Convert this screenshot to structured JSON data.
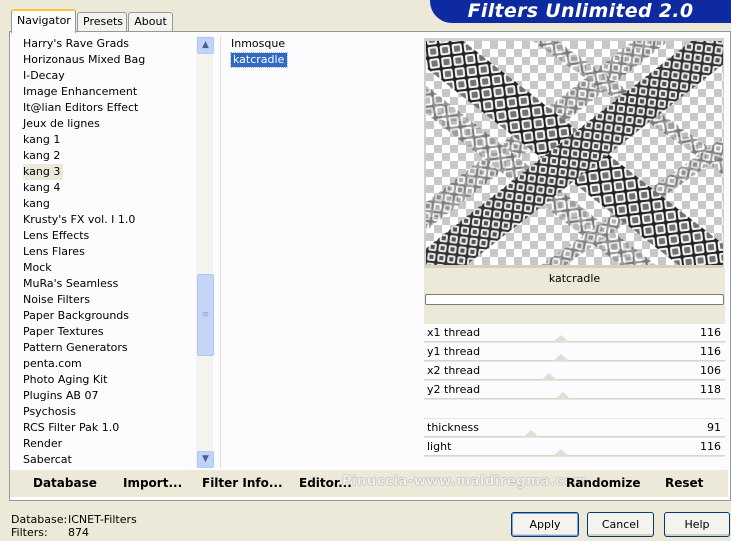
{
  "window": {
    "banner_title": "Filters Unlimited 2.0"
  },
  "tabs": [
    {
      "label": "Navigator",
      "active": true
    },
    {
      "label": "Presets",
      "active": false
    },
    {
      "label": "About",
      "active": false
    }
  ],
  "categories": {
    "selected": "kang 3",
    "items": [
      "Harry's Rave Grads",
      "Horizonaus Mixed Bag",
      "I-Decay",
      "Image Enhancement",
      "It@lian Editors Effect",
      "Jeux de lignes",
      "kang 1",
      "kang 2",
      "kang 3",
      "kang 4",
      "kang",
      "Krusty's FX vol. I 1.0",
      "Lens Effects",
      "Lens Flares",
      "Mock",
      "MuRa's Seamless",
      "Noise Filters",
      "Paper Backgrounds",
      "Paper Textures",
      "Pattern Generators",
      "penta.com",
      "Photo Aging Kit",
      "Plugins AB 07",
      "Psychosis",
      "RCS Filter Pak 1.0",
      "Render",
      "Sabercat"
    ]
  },
  "filters": {
    "selected": "katcradle",
    "items": [
      "Inmosque",
      "katcradle"
    ]
  },
  "preview": {
    "filter_name": "katcradle",
    "progress": 0
  },
  "params": [
    {
      "label": "x1 thread",
      "value": "116",
      "level": 0.455
    },
    {
      "label": "y1 thread",
      "value": "116",
      "level": 0.455
    },
    {
      "label": "x2 thread",
      "value": "106",
      "level": 0.416
    },
    {
      "label": "y2 thread",
      "value": "118",
      "level": 0.463
    },
    {
      "label": "",
      "value": "",
      "level": null
    },
    {
      "label": "thickness",
      "value": "91",
      "level": 0.357
    },
    {
      "label": "light",
      "value": "116",
      "level": 0.455
    },
    {
      "label": "",
      "value": "",
      "level": null
    }
  ],
  "commands": {
    "database": "Database",
    "import": "Import...",
    "filter_info": "Filter Info...",
    "editor": "Editor...",
    "randomize": "Randomize",
    "reset": "Reset"
  },
  "watermark": "Pinuccia-www.maldiregma.com",
  "footer": {
    "database_label": "Database:",
    "database_value": "ICNET-Filters",
    "filters_label": "Filters:",
    "filters_value": "874"
  },
  "buttons": {
    "apply": "Apply",
    "cancel": "Cancel",
    "help": "Help"
  },
  "colors": {
    "banner": "#0d2aa0",
    "selection": "#316ac5",
    "window": "#ece9d8"
  },
  "icons": {
    "scroll_up": "chevron-up-icon",
    "scroll_down": "chevron-down-icon",
    "grip": "grip-icon"
  }
}
